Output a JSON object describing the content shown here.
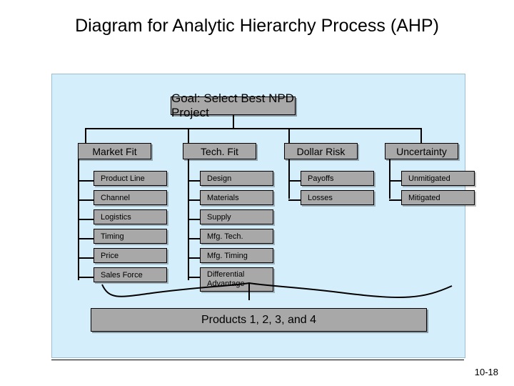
{
  "slide": {
    "title": "Diagram for Analytic Hierarchy Process (AHP)",
    "page_number": "10-18",
    "panel_bg": "#d5eefb",
    "node_fill": "#a8a8a8"
  },
  "diagram": {
    "goal": {
      "label": "Goal:  Select Best NPD Project"
    },
    "criteria": [
      {
        "label": "Market Fit"
      },
      {
        "label": "Tech. Fit"
      },
      {
        "label": "Dollar Risk"
      },
      {
        "label": "Uncertainty"
      }
    ],
    "subcriteria": {
      "market_fit": [
        {
          "label": "Product Line"
        },
        {
          "label": "Channel"
        },
        {
          "label": "Logistics"
        },
        {
          "label": "Timing"
        },
        {
          "label": "Price"
        },
        {
          "label": "Sales Force"
        }
      ],
      "tech_fit": [
        {
          "label": "Design"
        },
        {
          "label": "Materials"
        },
        {
          "label": "Supply"
        },
        {
          "label": "Mfg. Tech."
        },
        {
          "label": "Mfg. Timing"
        },
        {
          "label": "Differential Advantage"
        }
      ],
      "dollar_risk": [
        {
          "label": "Payoffs"
        },
        {
          "label": "Losses"
        }
      ],
      "uncertainty": [
        {
          "label": "Unmitigated"
        },
        {
          "label": "Mitigated"
        }
      ]
    },
    "alternatives": {
      "label": "Products 1, 2, 3, and 4"
    }
  }
}
